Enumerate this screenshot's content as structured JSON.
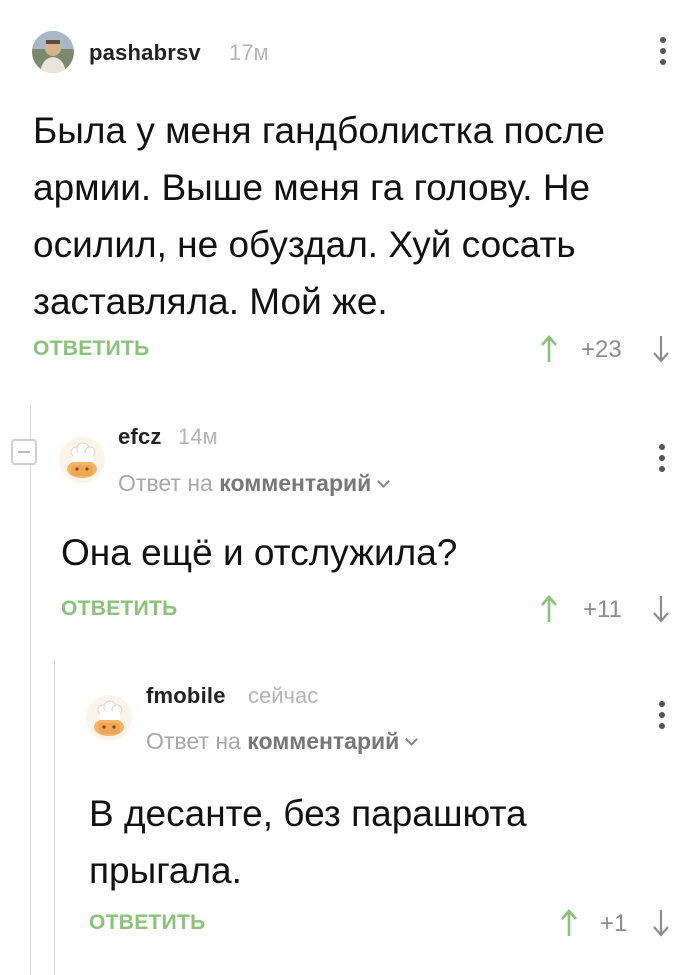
{
  "comments": [
    {
      "username": "pashabrsv",
      "time": "17м",
      "text_lines": [
        "Была у меня гандболистка после",
        "армии. Выше меня га голову. Не",
        "осилил, не обуздал. Хуй сосать",
        "заставляла. Мой же."
      ],
      "reply_label": "ОТВЕТИТЬ",
      "rating": "+23"
    },
    {
      "username": "efcz",
      "time": "14м",
      "reply_to_prefix": "Ответ на",
      "reply_to_link": "комментарий",
      "text_lines": [
        "Она ещё и отслужила?"
      ],
      "reply_label": "ОТВЕТИТЬ",
      "rating": "+11"
    },
    {
      "username": "fmobile",
      "time": "сейчас",
      "reply_to_prefix": "Ответ на",
      "reply_to_link": "комментарий",
      "text_lines": [
        "В десанте, без парашюта",
        "прыгала."
      ],
      "reply_label": "ОТВЕТИТЬ",
      "rating": "+1"
    }
  ],
  "colors": {
    "accent_green": "#8ac27a",
    "muted_gray": "#a8a8a8",
    "thread_line": "#d9d9d9"
  },
  "icons": [
    "avatar-photo",
    "avatar-chef-hat",
    "more-vert-icon",
    "arrow-up-icon",
    "arrow-down-icon",
    "collapse-minus-icon",
    "chevron-down-icon"
  ]
}
